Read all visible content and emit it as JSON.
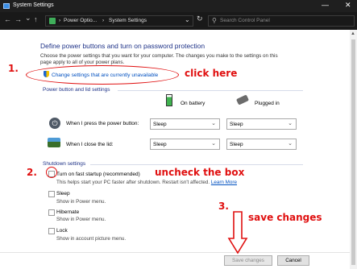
{
  "window": {
    "title": "System Settings",
    "minimize": "—",
    "close": "✕"
  },
  "nav": {
    "back": "←",
    "forward": "→",
    "recent": "⌄",
    "up": "↑",
    "crumbs": [
      "›",
      "Power Optio...",
      "›",
      "System Settings"
    ],
    "dropdown": "⌄",
    "refresh": "↻",
    "search_placeholder": "Search Control Panel"
  },
  "page": {
    "heading": "Define power buttons and turn on password protection",
    "description_line1": "Choose the power settings that you want for your computer. The changes you make to the settings on this",
    "description_line2": "page apply to all of your power plans.",
    "change_link": "Change settings that are currently unavailable"
  },
  "power_section": {
    "title": "Power button and lid settings",
    "on_battery": "On battery",
    "plugged_in": "Plugged in",
    "rows": [
      {
        "label": "When I press the power button:",
        "battery": "Sleep",
        "plugged": "Sleep"
      },
      {
        "label": "When I close the lid:",
        "battery": "Sleep",
        "plugged": "Sleep"
      }
    ]
  },
  "shutdown_section": {
    "title": "Shutdown settings",
    "fast_startup_label": "Turn on fast startup (recommended)",
    "fast_startup_desc": "This helps start your PC faster after shutdown. Restart isn't affected.",
    "learn_more": "Learn More",
    "options": [
      {
        "label": "Sleep",
        "desc": "Show in Power menu."
      },
      {
        "label": "Hibernate",
        "desc": "Show in Power menu."
      },
      {
        "label": "Lock",
        "desc": "Show in account picture menu."
      }
    ]
  },
  "buttons": {
    "save": "Save changes",
    "cancel": "Cancel"
  },
  "annotations": {
    "step1_num": "1.",
    "step1_text": "click here",
    "step2_num": "2.",
    "step2_text": "uncheck the box",
    "step3_num": "3.",
    "step3_text": "save changes",
    "color": "#e01010"
  }
}
